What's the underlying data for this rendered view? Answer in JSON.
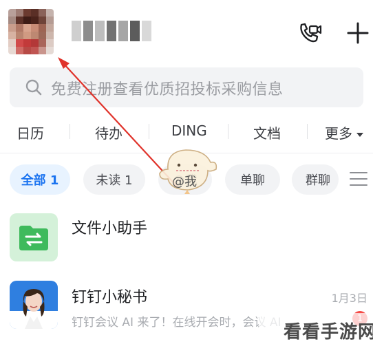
{
  "header": {
    "username": ""
  },
  "search": {
    "placeholder": "免费注册查看优质招投标采购信息"
  },
  "quick_tabs": [
    "日历",
    "待办",
    "DING",
    "文档",
    "更多"
  ],
  "filters": {
    "all": "全部 1",
    "unread": "未读 1",
    "mention": "@我",
    "single": "单聊",
    "group": "群聊"
  },
  "conversations": [
    {
      "title": "文件小助手",
      "subtitle": "",
      "date": ""
    },
    {
      "title": "钉钉小秘书",
      "subtitle": "钉钉会议 AI 来了！在线开会时，会议 AI",
      "date": "1月3日",
      "badge": "1"
    }
  ],
  "watermark": "看看手游网",
  "colors": {
    "accent": "#1a73f0",
    "file_helper": "#3fba5c",
    "badge": "#f54a45",
    "annotation_arrow": "#e0332b"
  }
}
